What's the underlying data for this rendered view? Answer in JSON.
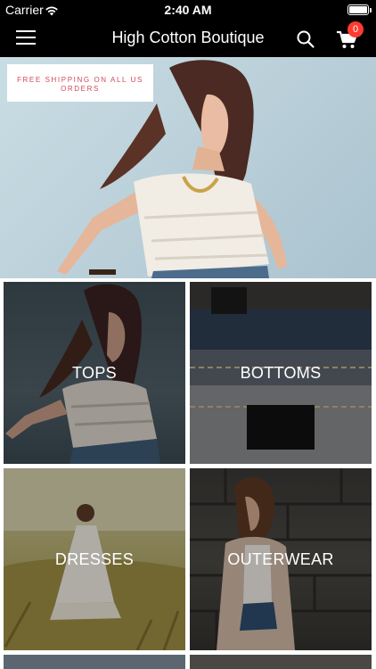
{
  "status_bar": {
    "carrier": "Carrier",
    "time": "2:40 AM",
    "battery_level": 1.0
  },
  "nav": {
    "title": "High Cotton Boutique",
    "menu_icon": "hamburger-menu-icon",
    "search_icon": "search-icon",
    "cart_icon": "shopping-cart-icon",
    "cart_count": "0"
  },
  "hero": {
    "promo_text": "FREE SHIPPING ON ALL US ORDERS"
  },
  "categories": [
    {
      "label": "TOPS"
    },
    {
      "label": "BOTTOMS"
    },
    {
      "label": "DRESSES"
    },
    {
      "label": "OUTERWEAR"
    }
  ],
  "colors": {
    "bar_background": "#000000",
    "badge": "#ff3b30",
    "promo_text": "#d2495a"
  }
}
